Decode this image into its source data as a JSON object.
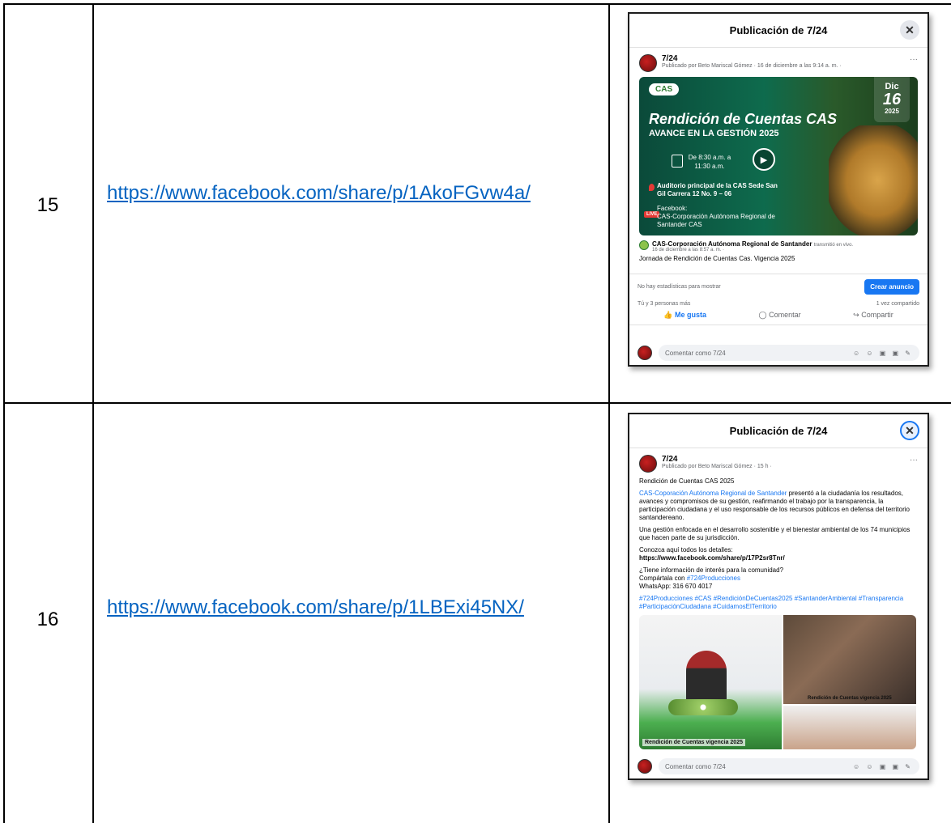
{
  "rows": [
    {
      "number": "15",
      "link": "https://www.facebook.com/share/p/1AkoFGvw4a/",
      "post": {
        "modal_title": "Publicación de 7/24",
        "author": "7/24",
        "author_meta": "Publicado por Beto Mariscal Gómez · 16 de diciembre a las 9:14 a. m. ·",
        "image": {
          "logo": "CAS",
          "month": "Dic",
          "day": "16",
          "year": "2025",
          "title": "Rendición de Cuentas CAS",
          "subtitle": "AVANCE EN LA GESTIÓN 2025",
          "time": "De 8:30 a.m. a 11:30 a.m.",
          "location": "Auditorio principal de la CAS Sede San Gil Carrera 12 No. 9 – 06",
          "facebook_label": "Facebook:",
          "facebook_page": "CAS-Corporación Autónoma Regional de Santander CAS",
          "live": "LIVE"
        },
        "shared_from": "CAS-Corporación Autónoma Regional de Santander",
        "shared_action": "transmitió en vivo.",
        "shared_time": "16 de diciembre a las 8:57 a. m. ·",
        "caption": "Jornada de Rendición de Cuentas Cas. Vigencia 2025",
        "stats_text": "No hay estadísticas para mostrar",
        "ad_button": "Crear anuncio",
        "reactions": "Tú y 3 personas más",
        "shares": "1 vez compartido",
        "like": "Me gusta",
        "comment": "Comentar",
        "share": "Compartir",
        "comment_placeholder": "Comentar como 7/24",
        "comment_icons": "☺ ☺ ▣ ▣ ✎"
      }
    },
    {
      "number": "16",
      "link": "https://www.facebook.com/share/p/1LBExi45NX/",
      "post": {
        "modal_title": "Publicación de 7/24",
        "author": "7/24",
        "author_meta": "Publicado por Beto Mariscal Gómez · 15 h ·",
        "heading": "Rendición de Cuentas CAS 2025",
        "para1_link": "CAS-Coporación Autónoma Regional de Santander",
        "para1_rest": " presentó a la ciudadanía los resultados, avances y compromisos de su gestión, reafirmando el trabajo por la transparencia, la participación ciudadana y el uso responsable de los recursos públicos en defensa del territorio santandereano.",
        "para2": "Una gestión enfocada en el desarrollo sostenible y el bienestar ambiental de los 74 municipios que hacen parte de su jurisdicción.",
        "details_label": "Conozca aquí todos los detalles:",
        "details_url": "https://www.facebook.com/share/p/17P2sr8Tnr/",
        "question": "¿Tiene información de interés para la comunidad?",
        "share_with": "Compártala con ",
        "share_tag": "#724Producciones",
        "whatsapp": "WhatsApp: 316 670 4017",
        "tags": "#724Producciones #CAS #RendiciónDeCuentas2025 #SantanderAmbiental #Transparencia #ParticipaciónCiudadana #CuidamosElTerritorio",
        "photo_caption_left": "Rendición de Cuentas vigencia 2025",
        "photo_caption_right": "Rendición de Cuentas vigencia 2025",
        "comment_placeholder": "Comentar como 7/24",
        "comment_icons": "☺ ☺ ▣ ▣ ✎"
      }
    }
  ]
}
